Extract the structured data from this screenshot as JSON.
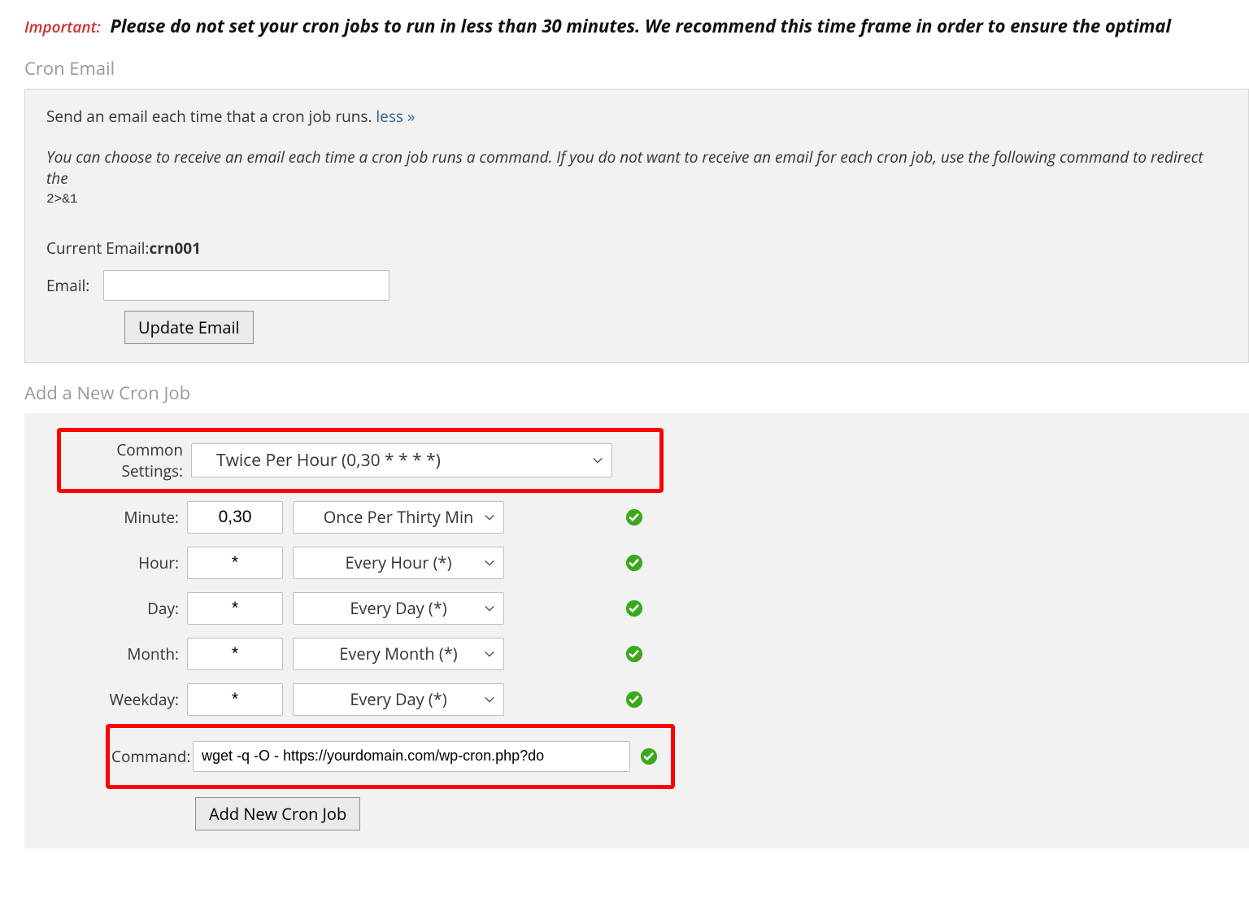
{
  "warning": {
    "label": "Important:",
    "text": "Please do not set your cron jobs to run in less than 30 minutes. We recommend this time frame in order to ensure the optimal"
  },
  "cron_email": {
    "heading": "Cron Email",
    "line1_text": "Send an email each time that a cron job runs. ",
    "less_link": "less »",
    "line2": "You can choose to receive an email each time a cron job runs a command. If you do not want to receive an email for each cron job, use the following command to redirect the",
    "code_fragment": "2>&1",
    "current_label": "Current Email:",
    "current_value": "crn001",
    "email_label": "Email:",
    "email_value": "",
    "update_btn": "Update Email"
  },
  "add_cron": {
    "heading": "Add a New Cron Job",
    "common_label": "Common Settings:",
    "common_value": "Twice Per Hour (0,30 * * * *)",
    "rows": [
      {
        "label": "Minute:",
        "value": "0,30",
        "select": "Once Per Thirty Min"
      },
      {
        "label": "Hour:",
        "value": "*",
        "select": "Every Hour (*)"
      },
      {
        "label": "Day:",
        "value": "*",
        "select": "Every Day (*)"
      },
      {
        "label": "Month:",
        "value": "*",
        "select": "Every Month (*)"
      },
      {
        "label": "Weekday:",
        "value": "*",
        "select": "Every Day (*)"
      }
    ],
    "command_label": "Command:",
    "command_value": "wget -q -O - https://yourdomain.com/wp-cron.php?do",
    "add_btn": "Add New Cron Job"
  }
}
